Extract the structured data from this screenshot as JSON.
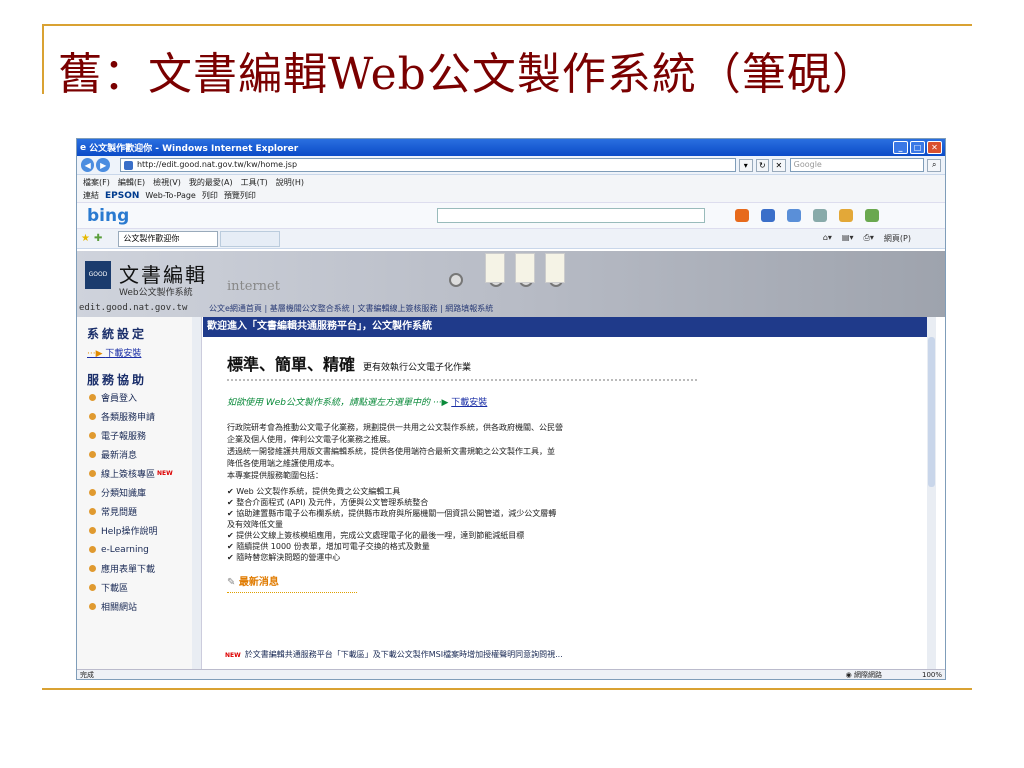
{
  "slide": {
    "title": "舊：文書編輯Web公文製作系統（筆硯）"
  },
  "browser": {
    "window_title": "公文製作歡迎你 - Windows Internet Explorer",
    "address": "http://edit.good.nat.gov.tw/kw/home.jsp",
    "search_placeholder": "Google",
    "menu": [
      "檔案(F)",
      "編輯(E)",
      "檢視(V)",
      "我的最愛(A)",
      "工具(T)",
      "說明(H)"
    ],
    "toolbar2": {
      "back_label": "連結",
      "epson": "EPSON",
      "web_to_page": "Web-To-Page",
      "print": "列印",
      "preview_print": "預覽列印"
    },
    "bing_label": "bing",
    "tab_label": "公文製作歡迎你",
    "tools": {
      "page": "網頁(P)"
    },
    "status_left": "完成",
    "status_zone": "網際網路",
    "status_zoom": "100%"
  },
  "site": {
    "logo_title": "文書編輯",
    "logo_badge": "GOOD",
    "logo_sub": "Web公文製作系統",
    "url_text": "edit.good.nat.gov.tw",
    "banner_decor": "internet",
    "top_nav": "公文e網通首頁 | 基層機關公文整合系統 | 文書編輯線上簽核服務 | 網路填報系統",
    "sidebar": {
      "heading_settings": "系統設定",
      "download_link": "下載安裝",
      "heading_service": "服務協助",
      "items": [
        {
          "label": "會員登入"
        },
        {
          "label": "各類服務申請"
        },
        {
          "label": "電子報服務"
        },
        {
          "label": "最新消息"
        },
        {
          "label": "線上簽核專區",
          "new": "NEW"
        },
        {
          "label": "分類知識庫"
        },
        {
          "label": "常見問題"
        },
        {
          "label": "Help操作說明"
        },
        {
          "label": "e-Learning"
        },
        {
          "label": "應用表單下載"
        },
        {
          "label": "下載區"
        },
        {
          "label": "相關網站"
        }
      ]
    },
    "main": {
      "header": "歡迎進入「文書編輯共通服務平台」，公文製作系統",
      "slogan": "標準、簡單、精確",
      "slogan_small": "更有效執行公文電子化作業",
      "guide_text": "如欲使用 Web公文製作系統，請點選左方選單中的",
      "guide_link": "下載安裝",
      "intro": [
        "行政院研考會為推動公文電子化業務，規劃提供一共用之公文製作系統，供各政府機關、公民營",
        "企業及個人使用，俾利公文電子化業務之推展。",
        "透過統一開發維護共用版文書編輯系統，提供各使用端符合最新文書規範之公文製作工具，並",
        "降低各使用端之維護使用成本。",
        "本專案提供服務範圍包括："
      ],
      "bullets": [
        "✔ Web 公文製作系統，提供免費之公文編輯工具",
        "✔ 整合介面程式 (API) 及元件，方便與公文管理系統整合",
        "✔ 協助建置縣市電子公布欄系統，提供縣市政府與所屬機關一個資訊公開管道，減少公文層轉",
        "   及有效降低文量",
        "✔ 提供公文線上簽核模組應用，完成公文處理電子化的最後一哩，達到節能減紙目標",
        "✔ 隨續提供 1000 份表單，增加可電子交換的格式及數量",
        "✔ 隨時替您解決問題的營運中心"
      ],
      "news_heading": "最新消息",
      "news_tag": "NEW",
      "news_item": "於文書編輯共通服務平台「下載區」及下載公文製作MSI檔案時增加授權聲明同意詢問視..."
    }
  }
}
